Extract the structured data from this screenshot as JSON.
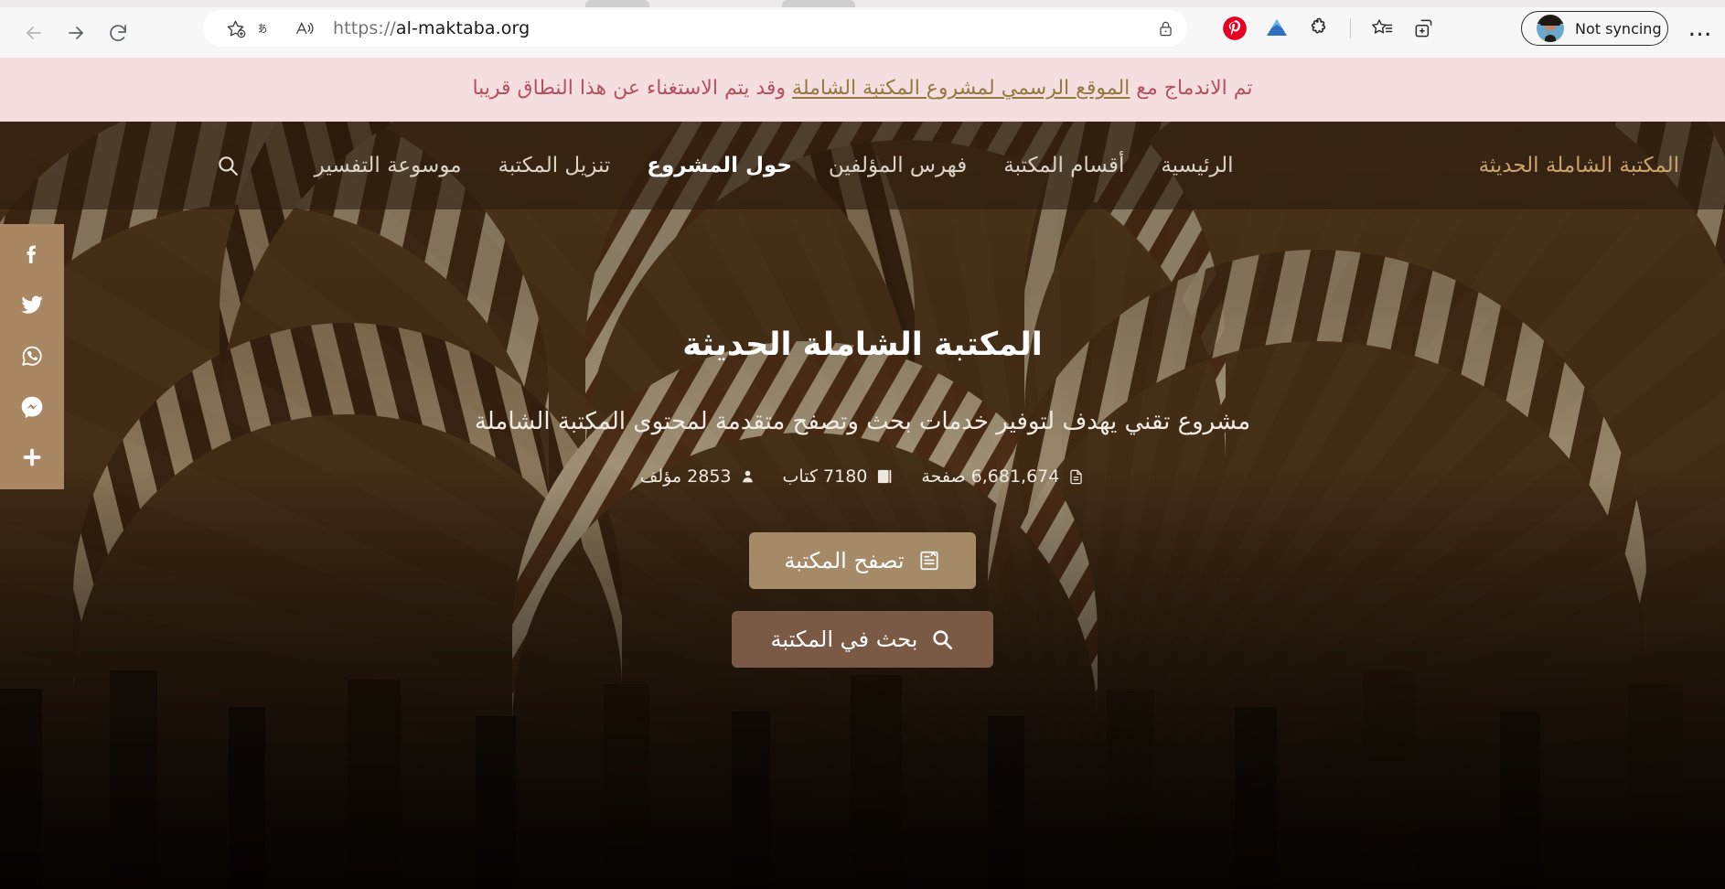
{
  "browser": {
    "back_label": "back",
    "forward_label": "forward",
    "reload_label": "reload",
    "url_scheme": "https://",
    "url_host": "al-maktaba.org",
    "url_full": "https://al-maktaba.org",
    "profile_label": "Not syncing",
    "more_label": "…",
    "toolbar_icons": [
      "read-aloud-icon",
      "translate-icon",
      "add-favorite-icon",
      "pinterest-icon",
      "extension-triangle-icon",
      "extensions-puzzle-icon",
      "collections-icon",
      "split-screen-icon"
    ]
  },
  "notice": {
    "before": "تم الاندماج مع ",
    "link": "الموقع الرسمي لمشروع المكتبة الشاملة",
    "after": " وقد يتم الاستغناء عن هذا النطاق قريبا",
    "text_color": "#b3515e",
    "link_color": "#93793f",
    "background": "#f5dedf"
  },
  "navbar": {
    "brand": "المكتبة الشاملة الحديثة",
    "brand_color": "#c9a46e",
    "search_icon": "search-icon",
    "items": [
      {
        "label": "الرئيسية",
        "active": false
      },
      {
        "label": "أقسام المكتبة",
        "active": false
      },
      {
        "label": "فهرس المؤلفين",
        "active": false
      },
      {
        "label": "حول المشروع",
        "active": true
      },
      {
        "label": "تنزيل المكتبة",
        "active": false
      },
      {
        "label": "موسوعة التفسير",
        "active": false
      }
    ]
  },
  "hero": {
    "title": "المكتبة الشاملة الحديثة",
    "subtitle": "مشروع تقني يهدف لتوفير خدمات بحث وتصفح متقدمة لمحتوى المكتبة الشاملة",
    "stats": [
      {
        "icon": "page-icon",
        "value": "6,681,674",
        "unit": "صفحة",
        "text": "6,681,674 صفحة"
      },
      {
        "icon": "book-icon",
        "value": "7180",
        "unit": "كتاب",
        "text": "7180 كتاب"
      },
      {
        "icon": "author-icon",
        "value": "2853",
        "unit": "مؤلف",
        "text": "2853 مؤلف"
      }
    ],
    "browse_button": {
      "label": "تصفح المكتبة",
      "icon": "book-open-icon",
      "color": "#a58a68"
    },
    "search_button": {
      "label": "بحث في المكتبة",
      "icon": "search-icon",
      "color": "#7a5a44"
    }
  },
  "share_rail": {
    "background": "#a98763",
    "items": [
      {
        "name": "facebook-share-icon",
        "label": "Facebook"
      },
      {
        "name": "twitter-share-icon",
        "label": "Twitter"
      },
      {
        "name": "whatsapp-share-icon",
        "label": "WhatsApp"
      },
      {
        "name": "messenger-share-icon",
        "label": "Messenger"
      },
      {
        "name": "more-share-icon",
        "label": "+"
      }
    ]
  }
}
